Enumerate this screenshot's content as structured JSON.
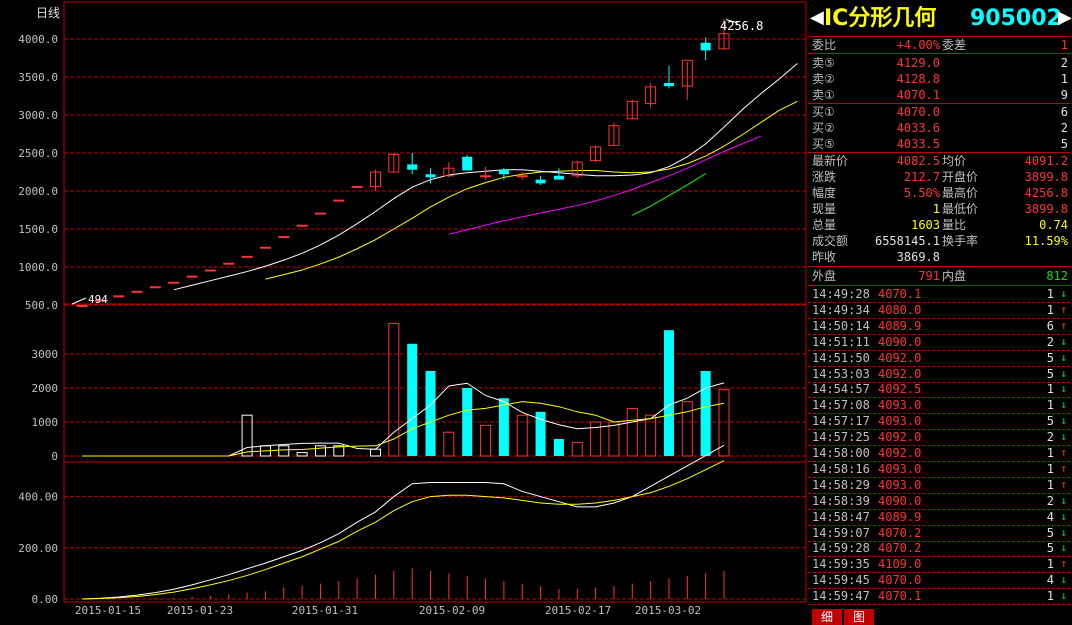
{
  "chart_data": {
    "type": "candlestick",
    "title": "日线",
    "dates": [
      "2015-01-15",
      "2015-01-23",
      "2015-01-31",
      "2015-02-09",
      "2015-02-17",
      "2015-03-02"
    ],
    "price_ticks": [
      "4000.0",
      "3500.0",
      "3000.0",
      "2500.0",
      "2000.0",
      "1500.0",
      "1000.0",
      "500.0"
    ],
    "volume_ticks": [
      "3000",
      "2000",
      "1000",
      "0"
    ],
    "indicator_ticks": [
      "400.00",
      "200.00",
      "0.00"
    ],
    "max_label": "4256.8",
    "min_label": "494",
    "candles": [
      [
        494,
        494,
        494,
        494
      ],
      [
        560,
        560,
        560,
        560
      ],
      [
        620,
        620,
        620,
        620
      ],
      [
        680,
        680,
        680,
        680
      ],
      [
        740,
        740,
        740,
        740
      ],
      [
        800,
        800,
        800,
        800
      ],
      [
        880,
        880,
        880,
        880
      ],
      [
        960,
        960,
        960,
        960
      ],
      [
        1050,
        1050,
        1050,
        1050
      ],
      [
        1140,
        1140,
        1140,
        1140
      ],
      [
        1260,
        1260,
        1260,
        1260
      ],
      [
        1400,
        1400,
        1400,
        1400
      ],
      [
        1550,
        1550,
        1550,
        1550
      ],
      [
        1710,
        1710,
        1710,
        1710
      ],
      [
        1880,
        1880,
        1880,
        1880
      ],
      [
        2060,
        2060,
        2060,
        2060
      ],
      [
        2060,
        2280,
        2000,
        2250
      ],
      [
        2250,
        2500,
        2240,
        2480
      ],
      [
        2350,
        2500,
        2220,
        2280
      ],
      [
        2220,
        2300,
        2100,
        2180
      ],
      [
        2200,
        2380,
        2180,
        2300
      ],
      [
        2450,
        2470,
        2270,
        2270
      ],
      [
        2200,
        2320,
        2150,
        2200
      ],
      [
        2280,
        2300,
        2150,
        2220
      ],
      [
        2200,
        2250,
        2150,
        2200
      ],
      [
        2150,
        2200,
        2080,
        2100
      ],
      [
        2200,
        2300,
        2150,
        2150
      ],
      [
        2200,
        2400,
        2170,
        2380
      ],
      [
        2400,
        2600,
        2380,
        2580
      ],
      [
        2600,
        2900,
        2600,
        2860
      ],
      [
        2950,
        3200,
        2950,
        3180
      ],
      [
        3150,
        3420,
        3100,
        3370
      ],
      [
        3420,
        3650,
        3350,
        3380
      ],
      [
        3380,
        3700,
        3200,
        3720
      ],
      [
        3950,
        4020,
        3720,
        3850
      ],
      [
        3870,
        4256.8,
        3870,
        4070
      ]
    ],
    "ma_price": [
      {
        "name": "MA5",
        "color": "#ffffff",
        "start": 5,
        "values": [
          700,
          760,
          820,
          880,
          940,
          1010,
          1090,
          1180,
          1290,
          1420,
          1570,
          1730,
          1900,
          2050,
          2150,
          2210,
          2240,
          2260,
          2280,
          2280,
          2260,
          2240,
          2220,
          2200,
          2200,
          2210,
          2240,
          2320,
          2450,
          2620,
          2840,
          3070,
          3280,
          3470,
          3680
        ]
      },
      {
        "name": "MA10",
        "color": "#ffff00",
        "start": 10,
        "values": [
          840,
          900,
          960,
          1040,
          1130,
          1240,
          1360,
          1500,
          1640,
          1790,
          1920,
          2030,
          2110,
          2180,
          2220,
          2250,
          2260,
          2270,
          2270,
          2250,
          2240,
          2250,
          2290,
          2360,
          2460,
          2590,
          2740,
          2900,
          3060,
          3180
        ]
      },
      {
        "name": "MA20",
        "color": "#ff00ff",
        "start": 20,
        "values": [
          1430,
          1490,
          1550,
          1610,
          1660,
          1710,
          1760,
          1810,
          1870,
          1940,
          2020,
          2110,
          2200,
          2300,
          2410,
          2520,
          2620,
          2720
        ]
      },
      {
        "name": "MA30",
        "color": "#00ff00",
        "start": 30,
        "values": [
          1680,
          1800,
          1940,
          2080,
          2230
        ]
      }
    ],
    "volume": [
      0,
      0,
      0,
      0,
      0,
      0,
      0,
      0,
      0,
      1200,
      300,
      300,
      100,
      300,
      300,
      0,
      200,
      3900,
      3300,
      2500,
      700,
      2000,
      900,
      1700,
      1200,
      1300,
      500,
      400,
      1000,
      1000,
      1400,
      1200,
      3700,
      1600,
      2500,
      1950,
      1600
    ],
    "vol_ma": [
      {
        "name": "VMA5",
        "color": "#ffffff",
        "values": [
          0,
          0,
          0,
          0,
          0,
          0,
          0,
          0,
          0,
          250,
          300,
          340,
          370,
          380,
          380,
          220,
          200,
          700,
          1100,
          1500,
          2060,
          2140,
          1780,
          1600,
          1280,
          1080,
          920,
          800,
          840,
          900,
          1000,
          1100,
          1500,
          1700,
          2000,
          2150,
          2300
        ]
      },
      {
        "name": "VMA10",
        "color": "#ffff00",
        "values": [
          0,
          0,
          0,
          0,
          0,
          0,
          0,
          0,
          0,
          120,
          150,
          180,
          190,
          230,
          270,
          290,
          300,
          500,
          800,
          1000,
          1200,
          1350,
          1400,
          1500,
          1600,
          1550,
          1450,
          1300,
          1200,
          1000,
          1050,
          1100,
          1200,
          1300,
          1450,
          1550,
          1600
        ]
      }
    ],
    "indicator_bars": [
      0,
      0,
      0,
      0,
      2,
      4,
      8,
      12,
      18,
      25,
      30,
      45,
      52,
      60,
      70,
      80,
      95,
      110,
      120,
      110,
      100,
      90,
      80,
      70,
      60,
      50,
      40,
      40,
      45,
      50,
      60,
      70,
      80,
      90,
      100,
      110,
      120
    ],
    "indicator_lines": [
      {
        "name": "L1",
        "color": "#ffffff",
        "values": [
          0,
          3,
          8,
          15,
          25,
          38,
          55,
          75,
          95,
          118,
          140,
          165,
          190,
          220,
          255,
          300,
          340,
          400,
          450,
          455,
          455,
          455,
          455,
          450,
          420,
          400,
          380,
          360,
          360,
          375,
          400,
          440,
          480,
          520,
          560,
          600
        ]
      },
      {
        "name": "L2",
        "color": "#ffff00",
        "values": [
          0,
          2,
          5,
          10,
          17,
          27,
          40,
          55,
          72,
          92,
          115,
          140,
          165,
          195,
          225,
          265,
          300,
          345,
          380,
          400,
          405,
          405,
          400,
          395,
          385,
          375,
          370,
          370,
          375,
          385,
          400,
          415,
          440,
          470,
          505,
          540
        ]
      }
    ],
    "indicator_max": 660
  },
  "quote": {
    "name": "IC分形几何",
    "code": "905002",
    "weibi_label": "委比",
    "weibi": "+4.00%",
    "weicha_label": "委差",
    "weicha": "1",
    "sell": [
      {
        "label": "卖⑤",
        "price": "4129.0",
        "vol": "2"
      },
      {
        "label": "卖②",
        "price": "4128.8",
        "vol": "1"
      },
      {
        "label": "卖①",
        "price": "4070.1",
        "vol": "9"
      }
    ],
    "buy": [
      {
        "label": "买①",
        "price": "4070.0",
        "vol": "6"
      },
      {
        "label": "买②",
        "price": "4033.6",
        "vol": "2"
      },
      {
        "label": "买⑤",
        "price": "4033.5",
        "vol": "5"
      }
    ],
    "stats": [
      {
        "l1": "最新价",
        "v1": "4082.5",
        "c1": "red",
        "l2": "均价",
        "v2": "4091.2",
        "c2": "red"
      },
      {
        "l1": "涨跌",
        "v1": "212.7",
        "c1": "red",
        "l2": "开盘价",
        "v2": "3899.8",
        "c2": "red"
      },
      {
        "l1": "幅度",
        "v1": "5.50%",
        "c1": "red",
        "l2": "最高价",
        "v2": "4256.8",
        "c2": "red"
      },
      {
        "l1": "现量",
        "v1": "1",
        "c1": "yellow",
        "l2": "最低价",
        "v2": "3899.8",
        "c2": "red"
      },
      {
        "l1": "总量",
        "v1": "1603",
        "c1": "yellow",
        "l2": "量比",
        "v2": "0.74",
        "c2": "yellow"
      },
      {
        "l1": "成交额",
        "v1": "6558145.1",
        "c1": "white",
        "l2": "换手率",
        "v2": "11.59%",
        "c2": "yellow"
      }
    ],
    "prev_label": "昨收",
    "prev": "3869.8",
    "outer_label": "外盘",
    "outer": "791",
    "inner_label": "内盘",
    "inner": "812",
    "ticks": [
      {
        "t": "14:49:28",
        "p": "4070.1",
        "v": "1",
        "dir": "down"
      },
      {
        "t": "14:49:34",
        "p": "4080.0",
        "v": "1",
        "dir": "up"
      },
      {
        "t": "14:50:14",
        "p": "4089.9",
        "v": "6",
        "dir": "up"
      },
      {
        "t": "14:51:11",
        "p": "4090.0",
        "v": "2",
        "dir": "down"
      },
      {
        "t": "14:51:50",
        "p": "4092.0",
        "v": "5",
        "dir": "down"
      },
      {
        "t": "14:53:03",
        "p": "4092.0",
        "v": "5",
        "dir": "down"
      },
      {
        "t": "14:54:57",
        "p": "4092.5",
        "v": "1",
        "dir": "down"
      },
      {
        "t": "14:57:08",
        "p": "4093.0",
        "v": "1",
        "dir": "down"
      },
      {
        "t": "14:57:17",
        "p": "4093.0",
        "v": "5",
        "dir": "down"
      },
      {
        "t": "14:57:25",
        "p": "4092.0",
        "v": "2",
        "dir": "down"
      },
      {
        "t": "14:58:00",
        "p": "4092.0",
        "v": "1",
        "dir": "up"
      },
      {
        "t": "14:58:16",
        "p": "4093.0",
        "v": "1",
        "dir": "up"
      },
      {
        "t": "14:58:29",
        "p": "4093.0",
        "v": "1",
        "dir": "up"
      },
      {
        "t": "14:58:39",
        "p": "4090.0",
        "v": "2",
        "dir": "down"
      },
      {
        "t": "14:58:47",
        "p": "4089.9",
        "v": "4",
        "dir": "down"
      },
      {
        "t": "14:59:07",
        "p": "4070.2",
        "v": "5",
        "dir": "down"
      },
      {
        "t": "14:59:28",
        "p": "4070.2",
        "v": "5",
        "dir": "down"
      },
      {
        "t": "14:59:35",
        "p": "4109.0",
        "v": "1",
        "dir": "up"
      },
      {
        "t": "14:59:45",
        "p": "4070.0",
        "v": "4",
        "dir": "down"
      },
      {
        "t": "14:59:47",
        "p": "4070.1",
        "v": "1",
        "dir": "down"
      }
    ],
    "tabs": [
      "细",
      "图"
    ]
  },
  "colors": {
    "up": "#ff3232",
    "down": "#00ffff",
    "grid": "#c00000",
    "text": "#c0c0c0"
  }
}
